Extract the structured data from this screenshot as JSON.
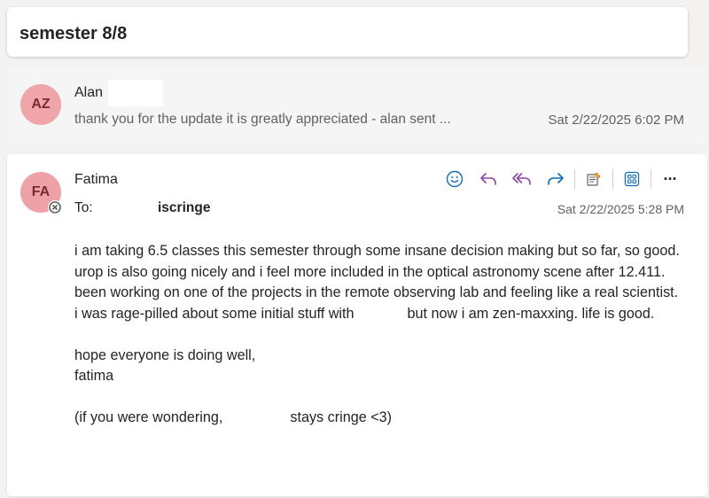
{
  "subject": "semester 8/8",
  "collapsed_message": {
    "initials": "AZ",
    "sender": "Alan",
    "preview": "thank you for the update it is greatly appreciated - alan sent ...",
    "time": "Sat 2/22/2025 6:02 PM"
  },
  "open_message": {
    "initials": "FA",
    "sender": "Fatima",
    "to_label": "To:",
    "to_value": "iscringe",
    "time": "Sat 2/22/2025 5:28 PM",
    "toolbar": {
      "emoji_icon": "smiley-icon",
      "reply_icon": "reply-icon",
      "reply_all_icon": "reply-all-icon",
      "forward_icon": "forward-icon",
      "immersive_reader_icon": "immersive-reader-icon",
      "apps_icon": "apps-grid-icon",
      "more_icon": "more-icon",
      "more_glyph": "···"
    },
    "body": {
      "line1": "i am taking 6.5 classes this semester through some insane decision making but so far, so good. urop is also going nicely and i feel more included in the optical astronomy scene after 12.411. been working on one of the projects in the remote observing lab and feeling like a real scientist.",
      "line2_a": "i was rage-pilled about some initial stuff with",
      "line2_b": "but now i am zen-maxxing. life is good.",
      "line3": "hope everyone is doing well,",
      "line4": "fatima",
      "line5_a": "(if you were wondering,",
      "line5_b": "stays cringe <3)"
    }
  },
  "colors": {
    "accent": "#0f6cbd",
    "purple_reply_all": "#8e44ad",
    "avatar_bg": "#f0a6a8",
    "avatar_text": "#7a2b2f"
  }
}
